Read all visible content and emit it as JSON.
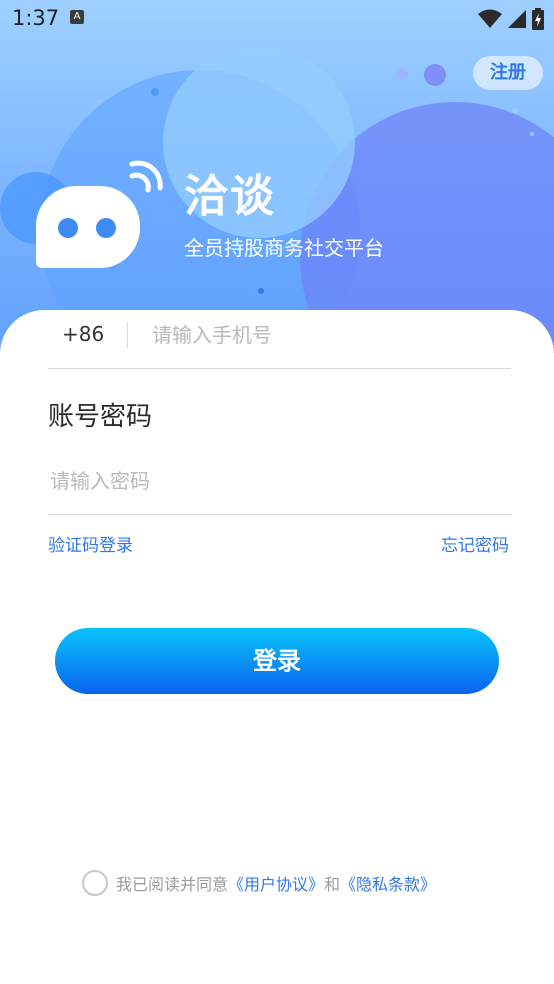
{
  "status_bar": {
    "time": "1:37",
    "notification_icon": "A"
  },
  "header": {
    "register_label": "注册",
    "app_name": "洽谈",
    "slogan": "全员持股商务社交平台"
  },
  "form": {
    "country_code": "+86",
    "phone_placeholder": "请输入手机号",
    "password_section_title": "账号密码",
    "password_placeholder": "请输入密码",
    "sms_login_label": "验证码登录",
    "forgot_password_label": "忘记密码",
    "login_label": "登录"
  },
  "agreement": {
    "prefix": "我已阅读并同意",
    "user_agreement": "《用户协议》",
    "conjunction": "和",
    "privacy_policy": "《隐私条款》"
  },
  "colors": {
    "accent": "#2f78e6",
    "button_top": "#09c3f9",
    "button_bottom": "#0a64f0"
  }
}
